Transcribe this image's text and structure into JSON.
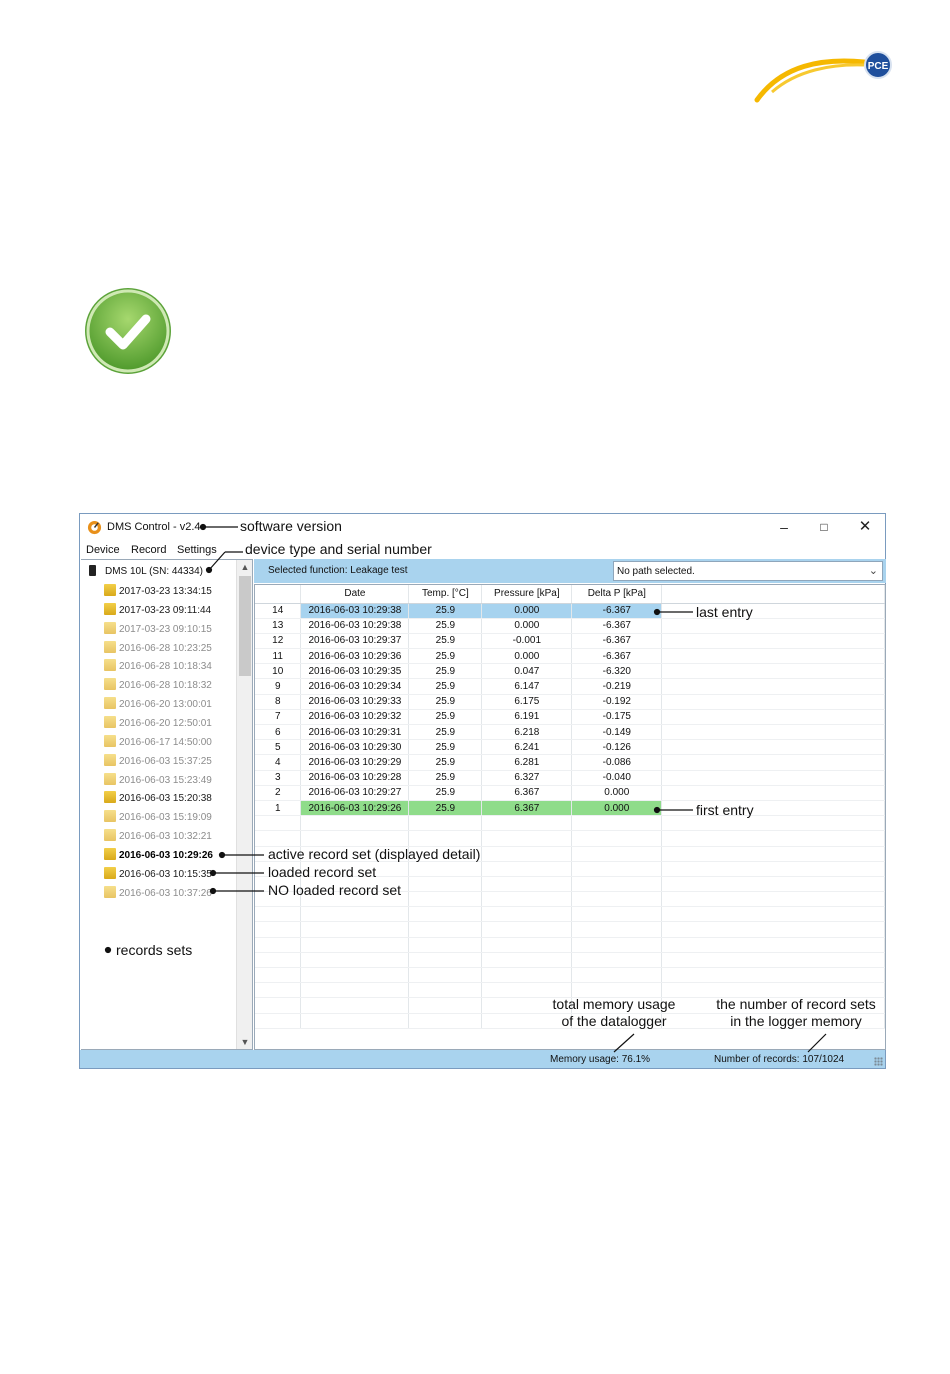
{
  "logo": {
    "text": "PCE",
    "color": "#f5b800",
    "badge_color": "#1f4f9c"
  },
  "window": {
    "title": "DMS Control - v2.4",
    "controls": {
      "minimize": "–",
      "maximize": "□",
      "close": "✕"
    },
    "menu": [
      "Device",
      "Record",
      "Settings"
    ]
  },
  "tree": {
    "device_label": "DMS 10L (SN: 44334)",
    "items": [
      {
        "label": "2017-03-23 13:34:15",
        "style": "normal"
      },
      {
        "label": "2017-03-23 09:11:44",
        "style": "normal"
      },
      {
        "label": "2017-03-23 09:10:15",
        "style": "grey"
      },
      {
        "label": "2016-06-28 10:23:25",
        "style": "grey"
      },
      {
        "label": "2016-06-28 10:18:34",
        "style": "grey"
      },
      {
        "label": "2016-06-28 10:18:32",
        "style": "grey"
      },
      {
        "label": "2016-06-20 13:00:01",
        "style": "grey"
      },
      {
        "label": "2016-06-20 12:50:01",
        "style": "grey"
      },
      {
        "label": "2016-06-17 14:50:00",
        "style": "grey"
      },
      {
        "label": "2016-06-03 15:37:25",
        "style": "grey"
      },
      {
        "label": "2016-06-03 15:23:49",
        "style": "grey"
      },
      {
        "label": "2016-06-03 15:20:38",
        "style": "normal"
      },
      {
        "label": "2016-06-03 15:19:09",
        "style": "grey"
      },
      {
        "label": "2016-06-03 10:32:21",
        "style": "grey"
      },
      {
        "label": "2016-06-03 10:29:26",
        "style": "bold"
      },
      {
        "label": "2016-06-03 10:15:35",
        "style": "normal"
      },
      {
        "label": "2016-06-03 10:37:26",
        "style": "grey"
      }
    ]
  },
  "function_bar": {
    "label": "Selected function: Leakage test",
    "path_value": "No path selected."
  },
  "grid": {
    "columns": [
      "",
      "Date",
      "Temp. [°C]",
      "Pressure [kPa]",
      "Delta P [kPa]",
      ""
    ],
    "rows": [
      [
        "14",
        "2016-06-03 10:29:38",
        "25.9",
        "0.000",
        "-6.367"
      ],
      [
        "13",
        "2016-06-03 10:29:38",
        "25.9",
        "0.000",
        "-6.367"
      ],
      [
        "12",
        "2016-06-03 10:29:37",
        "25.9",
        "-0.001",
        "-6.367"
      ],
      [
        "11",
        "2016-06-03 10:29:36",
        "25.9",
        "0.000",
        "-6.367"
      ],
      [
        "10",
        "2016-06-03 10:29:35",
        "25.9",
        "0.047",
        "-6.320"
      ],
      [
        "9",
        "2016-06-03 10:29:34",
        "25.9",
        "6.147",
        "-0.219"
      ],
      [
        "8",
        "2016-06-03 10:29:33",
        "25.9",
        "6.175",
        "-0.192"
      ],
      [
        "7",
        "2016-06-03 10:29:32",
        "25.9",
        "6.191",
        "-0.175"
      ],
      [
        "6",
        "2016-06-03 10:29:31",
        "25.9",
        "6.218",
        "-0.149"
      ],
      [
        "5",
        "2016-06-03 10:29:30",
        "25.9",
        "6.241",
        "-0.126"
      ],
      [
        "4",
        "2016-06-03 10:29:29",
        "25.9",
        "6.281",
        "-0.086"
      ],
      [
        "3",
        "2016-06-03 10:29:28",
        "25.9",
        "6.327",
        "-0.040"
      ],
      [
        "2",
        "2016-06-03 10:29:27",
        "25.9",
        "6.367",
        "0.000"
      ],
      [
        "1",
        "2016-06-03 10:29:26",
        "25.9",
        "6.367",
        "0.000"
      ]
    ],
    "empty_rows": 14,
    "highlight_colors": {
      "last": "#a7d3ef",
      "first": "#8fdc8a"
    }
  },
  "status": {
    "memory": "Memory usage: 76.1%",
    "records": "Number of records: 107/1024"
  },
  "annotations": {
    "software_version": "software version",
    "device_serial": "device type and serial number",
    "last_entry": "last entry",
    "first_entry": "first entry",
    "active_set": "active record set (displayed detail)",
    "loaded_set": "loaded record set",
    "not_loaded_set": "NO loaded record set",
    "records_sets": "records sets",
    "memory_usage_line1": "total memory usage",
    "memory_usage_line2": "of the datalogger",
    "record_sets_line1": "the number of record sets",
    "record_sets_line2": "in the logger memory"
  },
  "colors": {
    "accent": "#a9d3ee",
    "window_border": "#7a9bbf",
    "check_green": "#6ab13d"
  }
}
